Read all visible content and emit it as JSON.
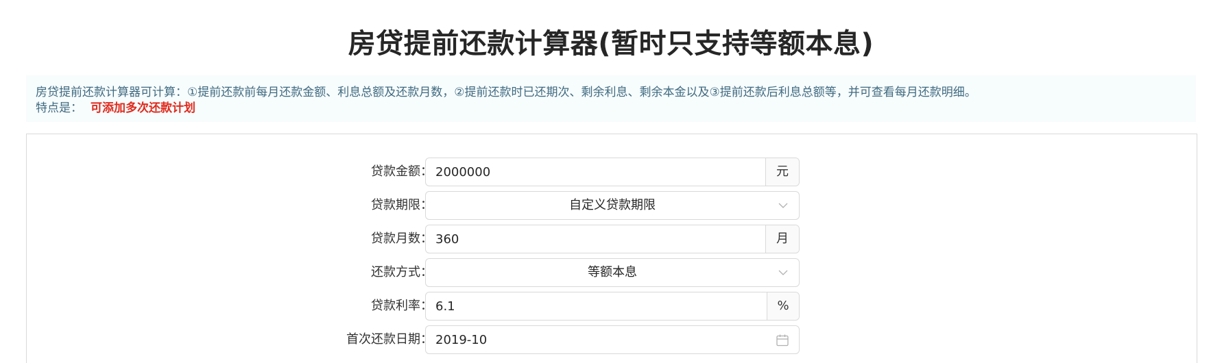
{
  "title": "房贷提前还款计算器(暂时只支持等额本息)",
  "info": {
    "description": "房贷提前还款计算器可计算：①提前还款前每月还款金额、利息总额及还款月数，②提前还款时已还期次、剩余利息、剩余本金以及③提前还款后利息总额等，并可查看每月还款明细。",
    "feature_label": "特点是：",
    "feature_value": "可添加多次还款计划"
  },
  "form": {
    "loan_amount": {
      "label": "贷款金额：",
      "value": "2000000",
      "unit": "元"
    },
    "loan_term": {
      "label": "贷款期限：",
      "value": "自定义贷款期限"
    },
    "loan_months": {
      "label": "贷款月数：",
      "value": "360",
      "unit": "月"
    },
    "repayment_method": {
      "label": "还款方式：",
      "value": "等额本息"
    },
    "interest_rate": {
      "label": "贷款利率：",
      "value": "6.1",
      "unit": "%"
    },
    "first_payment_date": {
      "label": "首次还款日期：",
      "value": "2019-10"
    }
  },
  "icons": {
    "select_arrow": "chevron-down-icon",
    "date_picker": "calendar-icon"
  },
  "colors": {
    "highlight": "#e02a1c",
    "info_text": "#3f6a80",
    "info_bg": "#f7fcfd",
    "border": "#d9d9d9"
  }
}
